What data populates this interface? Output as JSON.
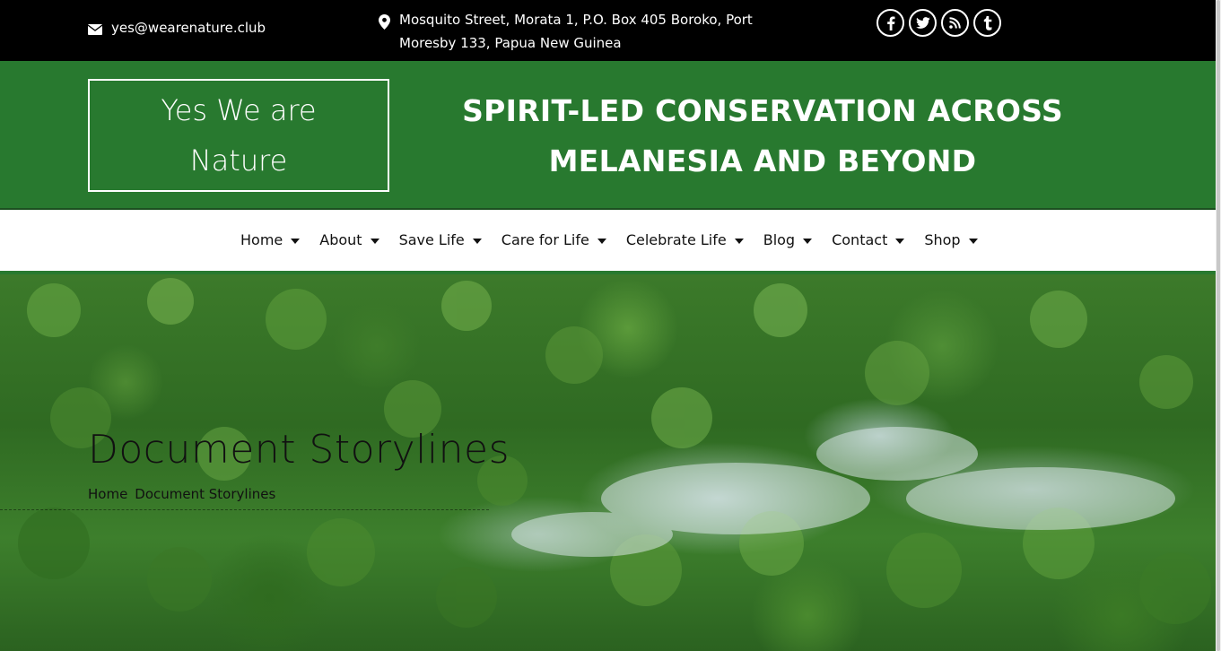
{
  "topbar": {
    "email": "yes@wearenature.club",
    "address_line1": "Mosquito Street, Morata 1, P.O. Box 405 Boroko, Port",
    "address_line2": "Moresby 133, Papua New Guinea",
    "social": [
      "facebook-icon",
      "twitter-icon",
      "rss-icon",
      "tumblr-icon"
    ]
  },
  "header": {
    "logo_line1": "Yes We are",
    "logo_line2": "Nature",
    "tagline_line1": "SPIRIT-LED CONSERVATION ACROSS",
    "tagline_line2": "MELANESIA AND BEYOND"
  },
  "nav": {
    "items": [
      {
        "label": "Home"
      },
      {
        "label": "About"
      },
      {
        "label": "Save Life"
      },
      {
        "label": "Care for Life"
      },
      {
        "label": "Celebrate Life"
      },
      {
        "label": "Blog"
      },
      {
        "label": "Contact"
      },
      {
        "label": "Shop"
      }
    ]
  },
  "hero": {
    "title": "Document Storylines",
    "breadcrumb_home": "Home",
    "breadcrumb_current": "Document Storylines"
  },
  "colors": {
    "brand_green": "#28792f",
    "topbar_bg": "#000000"
  }
}
